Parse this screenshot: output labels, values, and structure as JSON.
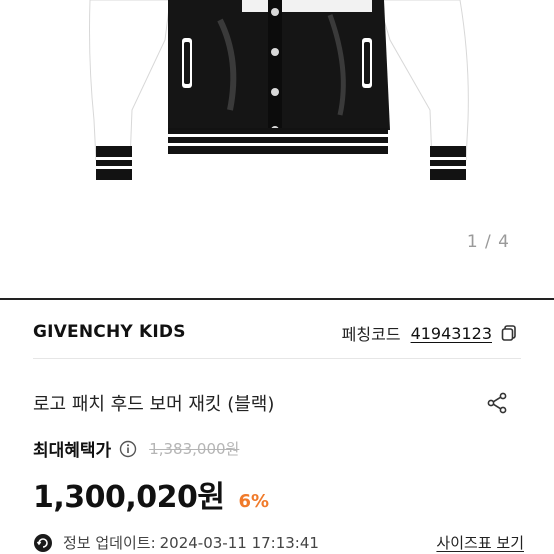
{
  "gallery": {
    "counter": "1 / 4"
  },
  "product": {
    "brand": "GIVENCHY KIDS",
    "code_label": "페칭코드",
    "code_value": "41943123",
    "title": "로고 패치 후드 보머 재킷 (블랙)",
    "max_benefit_label": "최대혜택가",
    "original_price": "1,383,000원",
    "price": "1,300,020원",
    "discount": "6%",
    "update_label": "정보 업데이트:",
    "update_time": "2024-03-11 17:13:41",
    "size_chart_link": "사이즈표 보기"
  },
  "colors": {
    "discount": "#f07a2a",
    "divider": "#222222",
    "strike": "#b5b5b5"
  },
  "icons": [
    "copy-icon",
    "share-icon",
    "info-icon",
    "update-icon"
  ]
}
